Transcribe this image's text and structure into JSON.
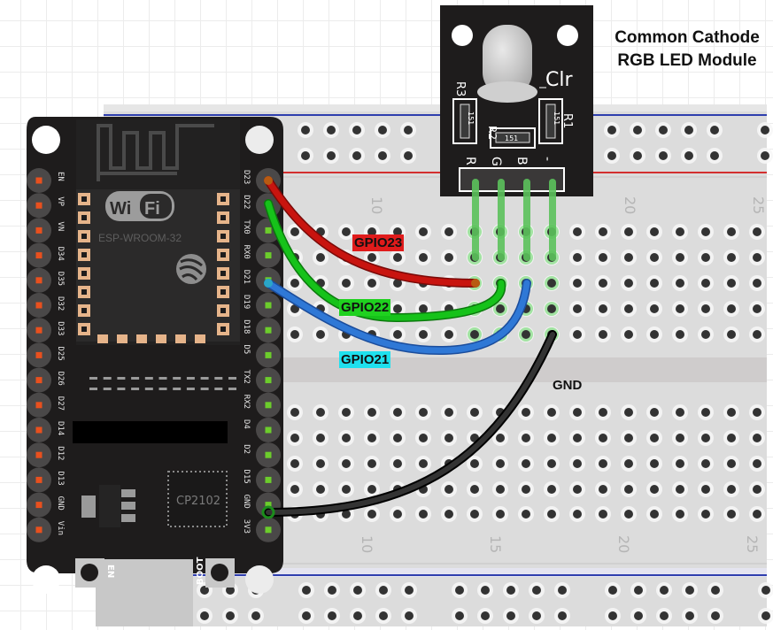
{
  "title": {
    "line1": "Common Cathode",
    "line2": "RGB LED Module"
  },
  "colors": {
    "board": "#1e1c1c",
    "breadboard": "#dcdcdc",
    "rail_red": "#d32f2f",
    "rail_blue": "#2f3fae",
    "wire_red": "#c8140f",
    "wire_green": "#16c21a",
    "wire_blue": "#2f78d6",
    "wire_black": "#1a1a1a",
    "pin_left": "#e8501e",
    "pin_right": "#6ccd2c"
  },
  "esp32": {
    "module_name": "ESP-WROOM-32",
    "wifi_logo": [
      "Wi",
      "Fi"
    ],
    "usb_chip": "CP2102",
    "buttons": {
      "en": "EN",
      "boot": "BOOT"
    },
    "pins_left": [
      "EN",
      "VP",
      "VN",
      "D34",
      "D35",
      "D32",
      "D33",
      "D25",
      "D26",
      "D27",
      "D14",
      "D12",
      "D13",
      "GND",
      "Vin"
    ],
    "pins_right": [
      "D23",
      "D22",
      "TX0",
      "RX0",
      "D21",
      "D19",
      "D18",
      "D5",
      "TX2",
      "RX2",
      "D4",
      "D2",
      "D15",
      "GND",
      "3V3"
    ]
  },
  "led_module": {
    "label": "Clr",
    "resistors": [
      {
        "name": "R3",
        "value": "151"
      },
      {
        "name": "R2",
        "value": "151"
      },
      {
        "name": "R1",
        "value": "151"
      }
    ],
    "pins": [
      "R",
      "G",
      "B",
      "-"
    ]
  },
  "breadboard": {
    "column_numbers_top": [
      "10",
      "20",
      "25"
    ],
    "column_numbers_bottom": [
      "10",
      "15",
      "20",
      "25"
    ]
  },
  "wires": [
    {
      "label": "GPIO23",
      "from": "D23",
      "to": "R",
      "color": "red",
      "label_bg": "#e01b1b"
    },
    {
      "label": "GPIO22",
      "from": "D22",
      "to": "G",
      "color": "green",
      "label_bg": "#1fd11f"
    },
    {
      "label": "GPIO21",
      "from": "D21",
      "to": "B",
      "color": "blue",
      "label_bg": "#1fe0ee"
    },
    {
      "label": "GND",
      "from": "GND",
      "to": "-",
      "color": "black",
      "label_bg": ""
    }
  ]
}
